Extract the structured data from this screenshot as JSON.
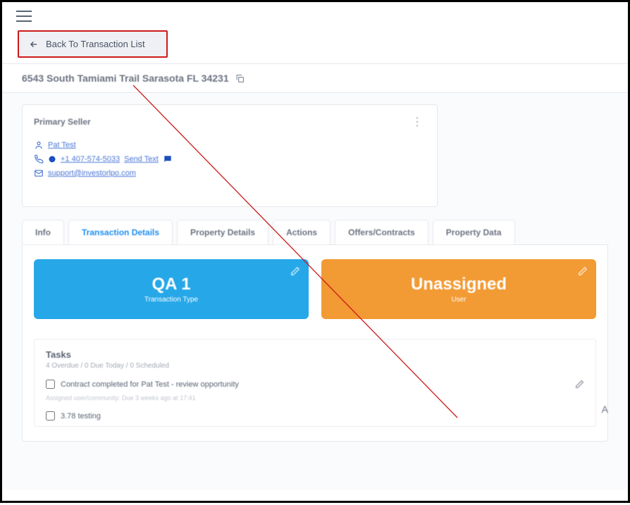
{
  "topbar": {},
  "back": {
    "label": "Back To Transaction List"
  },
  "address": {
    "text": "6543 South Tamiami Trail Sarasota FL 34231"
  },
  "seller_card": {
    "title": "Primary Seller",
    "name": "Pat Test",
    "phone": "+1 407-574-5033",
    "phone_tag": "Send Text",
    "email": "support@investorlpo.com"
  },
  "tabs": [
    {
      "label": "Info",
      "active": false
    },
    {
      "label": "Transaction Details",
      "active": true
    },
    {
      "label": "Property Details",
      "active": false
    },
    {
      "label": "Actions",
      "active": false
    },
    {
      "label": "Offers/Contracts",
      "active": false
    },
    {
      "label": "Property Data",
      "active": false
    }
  ],
  "cards": {
    "type": {
      "title": "QA 1",
      "subtitle": "Transaction Type"
    },
    "assign": {
      "title": "Unassigned",
      "subtitle": "User"
    }
  },
  "tasks": {
    "title": "Tasks",
    "subtitle": "4 Overdue / 0 Due Today / 0 Scheduled",
    "items": [
      {
        "text": "Contract completed for Pat Test - review opportunity",
        "sub": "Assigned user/community: Due 3 weeks ago at 17:41"
      },
      {
        "text": "3.78 testing"
      }
    ]
  },
  "side_letter": "A"
}
